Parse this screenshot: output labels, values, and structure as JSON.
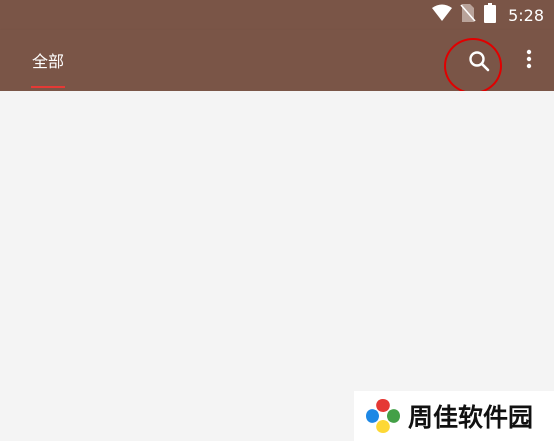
{
  "status_bar": {
    "time": "5:28",
    "icons": [
      "wifi-icon",
      "no-sim-icon",
      "battery-icon"
    ],
    "background": "#7a5547"
  },
  "app_bar": {
    "background": "#7a5547",
    "tabs": [
      {
        "label": "全部",
        "selected": true
      }
    ],
    "indicator_color": "#e53935",
    "actions": [
      "search-icon",
      "more-vert-icon"
    ],
    "highlight_color": "#e10000"
  },
  "content": {
    "background": "#f4f4f4"
  },
  "watermark": {
    "text": "周佳软件园"
  }
}
